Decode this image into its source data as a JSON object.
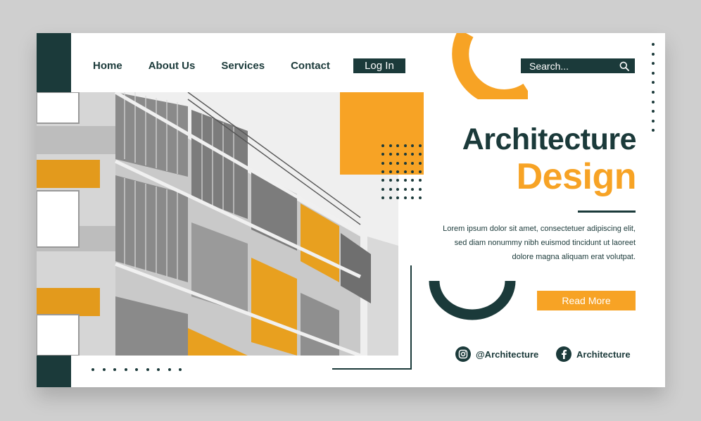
{
  "nav": {
    "items": [
      "Home",
      "About Us",
      "Services",
      "Contact"
    ],
    "login_label": "Log In"
  },
  "search": {
    "placeholder": "Search..."
  },
  "hero": {
    "title_line1": "Architecture",
    "title_line2": "Design",
    "description": "Lorem ipsum dolor sit amet, consectetuer adipiscing elit, sed diam nonummy nibh euismod tincidunt ut laoreet dolore magna aliquam erat volutpat.",
    "cta_label": "Read More"
  },
  "social": {
    "instagram_handle": "@Architecture",
    "facebook_name": "Architecture"
  },
  "icons": [
    "search-icon",
    "instagram-icon",
    "facebook-icon"
  ],
  "colors": {
    "primary": "#1b3a3a",
    "accent": "#f7a325",
    "background": "#ffffff"
  }
}
